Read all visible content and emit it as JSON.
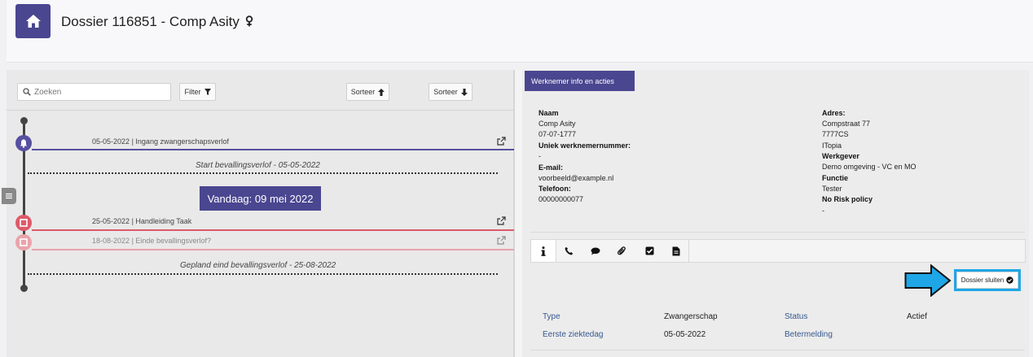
{
  "header": {
    "title": "Dossier 116851 - Comp Asity",
    "gender_icon": "female-icon"
  },
  "left": {
    "search": {
      "placeholder": "Zoeken",
      "value": ""
    },
    "filter_label": "Filter",
    "sort_asc_label": "Sorteer",
    "sort_desc_label": "Sorteer",
    "timeline": {
      "item1": {
        "date": "05-05-2022",
        "sep": "|",
        "text": "Ingang zwangerschapsverlof"
      },
      "note1": "Start bevallingsverlof - 05-05-2022",
      "today": "Vandaag: 09 mei 2022",
      "item2": {
        "date": "25-05-2022",
        "sep": "|",
        "text": "Handleiding Taak"
      },
      "item3": {
        "date": "18-08-2022",
        "sep": "|",
        "text": "Einde bevallingsverlof?"
      },
      "note2": "Gepland eind bevallingsverlof - 25-08-2022"
    },
    "colors": {
      "purple": "#5750a0",
      "red": "#dc5a6a",
      "red_light": "#e9a3ab"
    }
  },
  "right": {
    "tab_label": "Werknemer info en acties",
    "info_left": {
      "naam_label": "Naam",
      "naam_value": "Comp Asity",
      "dob_value": "07-07-1777",
      "unique_label": "Uniek werknemernummer:",
      "unique_value": "-",
      "email_label": "E-mail:",
      "email_value": "voorbeeld@example.nl",
      "phone_label": "Telefoon:",
      "phone_value": "00000000077"
    },
    "info_right": {
      "adres_label": "Adres:",
      "street": "Compstraat 77",
      "postcode": "7777CS",
      "city": "ITopia",
      "werkgever_label": "Werkgever",
      "werkgever_value": "Demo omgeving - VC en MO",
      "functie_label": "Functie",
      "functie_value": "Tester",
      "norisk_label": "No Risk policy",
      "norisk_value": "-"
    },
    "tabs": [
      "info-icon",
      "phone-icon",
      "chat-icon",
      "paperclip-icon",
      "checkbox-icon",
      "document-icon"
    ],
    "close_button": "Dossier sluiten",
    "details": {
      "type_label": "Type",
      "type_value": "Zwangerschap",
      "status_label": "Status",
      "status_value": "Actief",
      "first_sick_label": "Eerste ziektedag",
      "first_sick_value": "05-05-2022",
      "betermelding_label": "Betermelding"
    },
    "colors": {
      "accent": "#4a4690",
      "arrow": "#1ea6e6",
      "link": "#35588f"
    }
  }
}
